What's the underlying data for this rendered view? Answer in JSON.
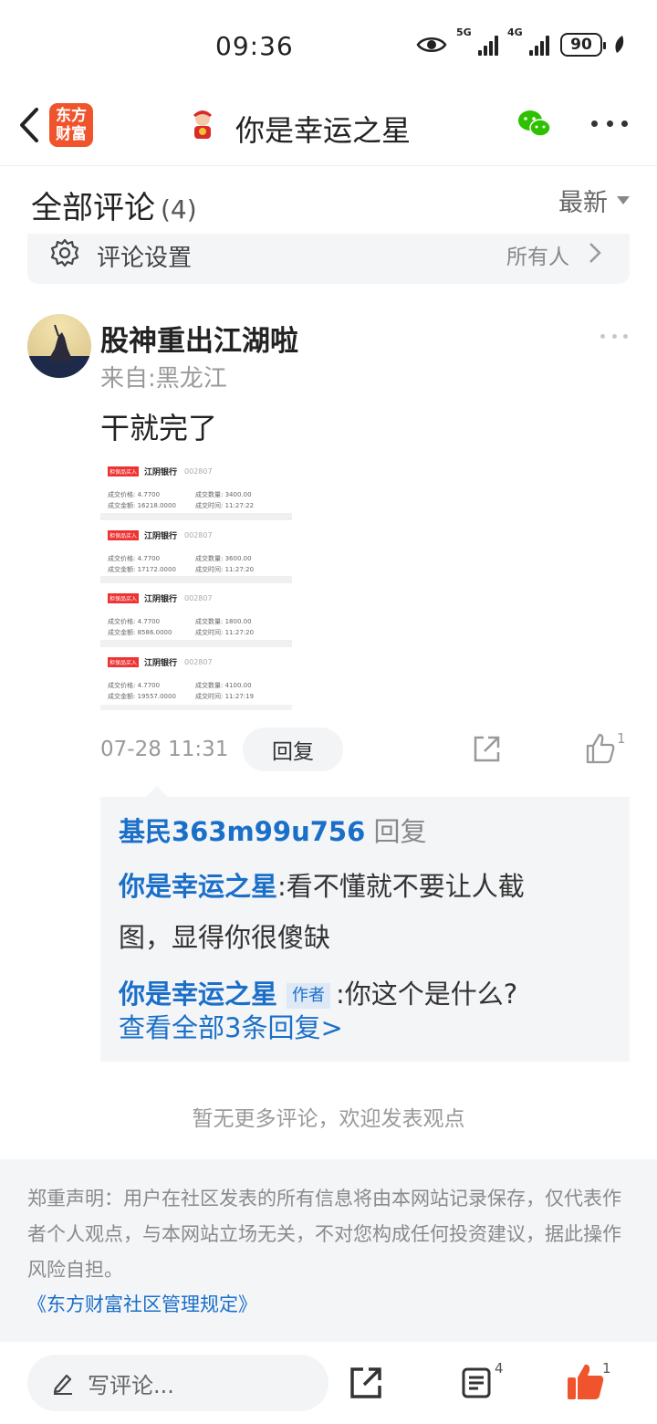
{
  "status_bar": {
    "time": "09:36",
    "battery": "90",
    "signal1": "5G",
    "signal2": "4G"
  },
  "nav": {
    "app_logo_text": "东方财富",
    "title": "你是幸运之星"
  },
  "comments_header": {
    "title": "全部评论",
    "count": "(4)",
    "sort_label": "最新"
  },
  "settings": {
    "label": "评论设置",
    "value": "所有人"
  },
  "comment": {
    "author": "股神重出江湖啦",
    "location": "来自:黑龙江",
    "text": "干就完了",
    "time": "07-28 11:31",
    "reply_label": "回复",
    "like_count": "1",
    "trade_image": {
      "cards": [
        {
          "badge": "担保品买入",
          "name": "江阴银行",
          "code": "002807",
          "price_label": "成交价格:",
          "price": "4.7700",
          "qty_label": "成交数量:",
          "qty": "3400.00",
          "amount_label": "成交金额:",
          "amount": "16218.0000",
          "time_label": "成交时间:",
          "time": "11:27:22"
        },
        {
          "badge": "担保品买入",
          "name": "江阴银行",
          "code": "002807",
          "price_label": "成交价格:",
          "price": "4.7700",
          "qty_label": "成交数量:",
          "qty": "3600.00",
          "amount_label": "成交金额:",
          "amount": "17172.0000",
          "time_label": "成交时间:",
          "time": "11:27:20"
        },
        {
          "badge": "担保品买入",
          "name": "江阴银行",
          "code": "002807",
          "price_label": "成交价格:",
          "price": "4.7700",
          "qty_label": "成交数量:",
          "qty": "1800.00",
          "amount_label": "成交金额:",
          "amount": "8586.0000",
          "time_label": "成交时间:",
          "time": "11:27:20"
        },
        {
          "badge": "担保品买入",
          "name": "江阴银行",
          "code": "002807",
          "price_label": "成交价格:",
          "price": "4.7700",
          "qty_label": "成交数量:",
          "qty": "4100.00",
          "amount_label": "成交金额:",
          "amount": "19557.0000",
          "time_label": "成交时间:",
          "time": "11:27:19"
        }
      ]
    },
    "replies": {
      "line1_user": "基民363m99u756",
      "line1_action": "回复",
      "line2_user": "你是幸运之星",
      "line2_text": ":看不懂就不要让人截",
      "line2_text_cont": "图，显得你很傻缺",
      "line3_user": "你是幸运之星",
      "line3_tag": "作者",
      "line3_text": ":你这个是什么?",
      "view_all": "查看全部3条回复>"
    }
  },
  "no_more": "暂无更多评论，欢迎发表观点",
  "disclaimer": {
    "text": "郑重声明：用户在社区发表的所有信息将由本网站记录保存，仅代表作者个人观点，与本网站立场无关，不对您构成任何投资建议，据此操作风险自担。",
    "link": "《东方财富社区管理规定》"
  },
  "bottom_bar": {
    "input_placeholder": "写评论...",
    "comments_count": "4",
    "like_count": "1"
  },
  "colors": {
    "accent_blue": "#1a6fc9",
    "like_orange": "#f0542c",
    "wechat_green": "#2dc100"
  }
}
